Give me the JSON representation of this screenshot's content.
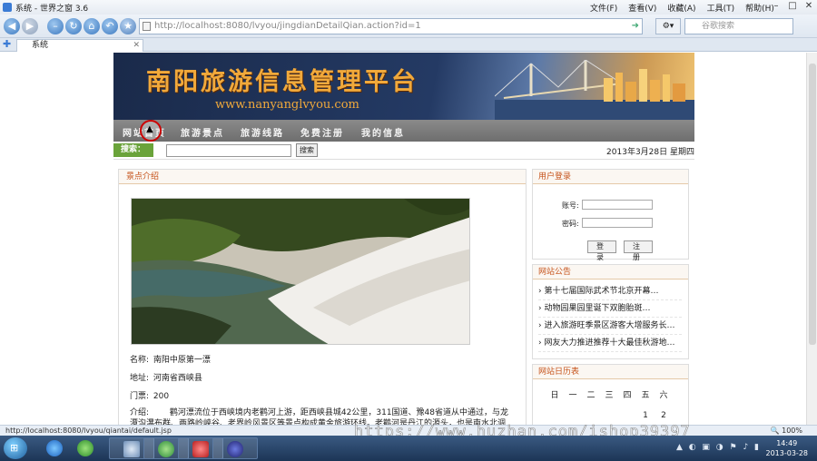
{
  "window": {
    "title": "系统 - 世界之窗 3.6",
    "menus": [
      "文件(F)",
      "查看(V)",
      "收藏(A)",
      "工具(T)",
      "帮助(H)"
    ]
  },
  "navbar": {
    "address": "http://localhost:8080/lvyou/jingdianDetailQian.action?id=1",
    "search_placeholder": "谷歌搜索"
  },
  "tab": {
    "label": "系统"
  },
  "site": {
    "title": "南阳旅游信息管理平台",
    "url": "www.nanyanglvyou.com",
    "nav": [
      "网站首页",
      "旅游景点",
      "旅游线路",
      "免费注册",
      "我的信息"
    ],
    "search_label": "搜索：",
    "search_button": "搜索",
    "date": "2013年3月28日 星期四"
  },
  "attraction": {
    "section_title": "景点介绍",
    "name_label": "名称:",
    "name": "南阳中原第一漂",
    "address_label": "地址:",
    "address": "河南省西峡县",
    "ticket_label": "门票:",
    "ticket": "200",
    "intro_label": "介绍:",
    "intro": "鹳河漂流位于西峡境内老鹳河上游，距西峡县城42公里，311国道、豫48省道从中通过，与龙潭沟瀑布群、两路岭峡谷、老界岭风景区等景点构成黄金旅游环线。老鹳河是丹江的源头，也是南水北调中线工程。上游重要水源。"
  },
  "login": {
    "title": "用户登录",
    "account_label": "账号:",
    "password_label": "密码:",
    "login_button": "登 录",
    "register_button": "注 册"
  },
  "notices": {
    "title": "网站公告",
    "items": [
      "第十七届国际武术节北京开幕…",
      "动物园果园里诞下双胞胎斑…",
      "进入旅游旺季景区游客大增服务长…",
      "网友大力推进推荐十大最佳秋游地…"
    ]
  },
  "calendar": {
    "title": "网站日历表",
    "weekdays": [
      "日",
      "一",
      "二",
      "三",
      "四",
      "五",
      "六"
    ],
    "first_days": [
      "",
      "",
      "",
      "",
      "",
      "1",
      "2"
    ]
  },
  "status": {
    "url": "http://localhost:8080/lvyou/qiantai/default.jsp",
    "zoom": "100%"
  },
  "taskbar": {
    "time": "14:49",
    "date": "2013-03-28"
  },
  "watermark": "https://www.huzhan.com/ishop39397",
  "colors": {
    "accent_orange": "#f1a93b",
    "nav_gray": "#7a7a7a",
    "search_green": "#6aa33a",
    "section_title": "#c6531b"
  }
}
